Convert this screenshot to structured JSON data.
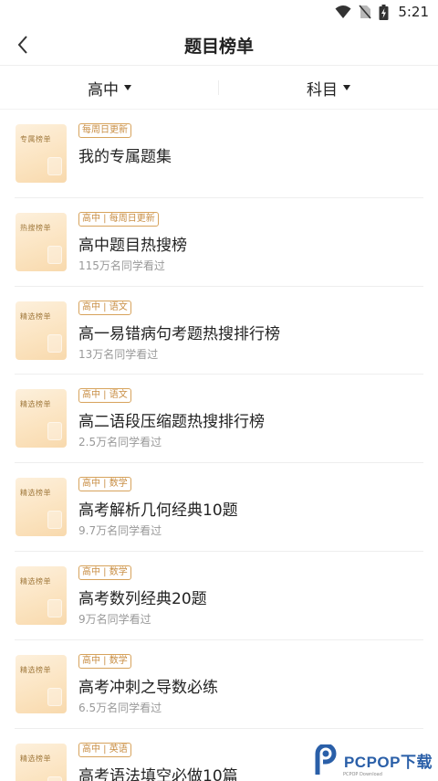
{
  "status_bar": {
    "time": "5:21"
  },
  "header": {
    "title": "题目榜单"
  },
  "filters": {
    "level": "高中",
    "subject": "科目"
  },
  "list": [
    {
      "cover": "专属榜单",
      "tag": "每周日更新",
      "title": "我的专属题集",
      "meta": ""
    },
    {
      "cover": "热搜榜单",
      "tag": "高中 | 每周日更新",
      "title": "高中题目热搜榜",
      "meta": "115万名同学看过"
    },
    {
      "cover": "精选榜单",
      "tag": "高中 | 语文",
      "title": "高一易错病句考题热搜排行榜",
      "meta": "13万名同学看过"
    },
    {
      "cover": "精选榜单",
      "tag": "高中 | 语文",
      "title": "高二语段压缩题热搜排行榜",
      "meta": "2.5万名同学看过"
    },
    {
      "cover": "精选榜单",
      "tag": "高中 | 数学",
      "title": "高考解析几何经典10题",
      "meta": "9.7万名同学看过"
    },
    {
      "cover": "精选榜单",
      "tag": "高中 | 数学",
      "title": "高考数列经典20题",
      "meta": "9万名同学看过"
    },
    {
      "cover": "精选榜单",
      "tag": "高中 | 数学",
      "title": "高考冲刺之导数必练",
      "meta": "6.5万名同学看过"
    },
    {
      "cover": "精选榜单",
      "tag": "高中 | 英语",
      "title": "高考语法填空必做10篇",
      "meta": ""
    }
  ],
  "watermark": {
    "brand": "PCPOP下载",
    "sub": "PCPOP Download"
  },
  "colors": {
    "tag": "#c88e44",
    "cover": "#fbe3bf",
    "brand": "#2a5fa8"
  }
}
